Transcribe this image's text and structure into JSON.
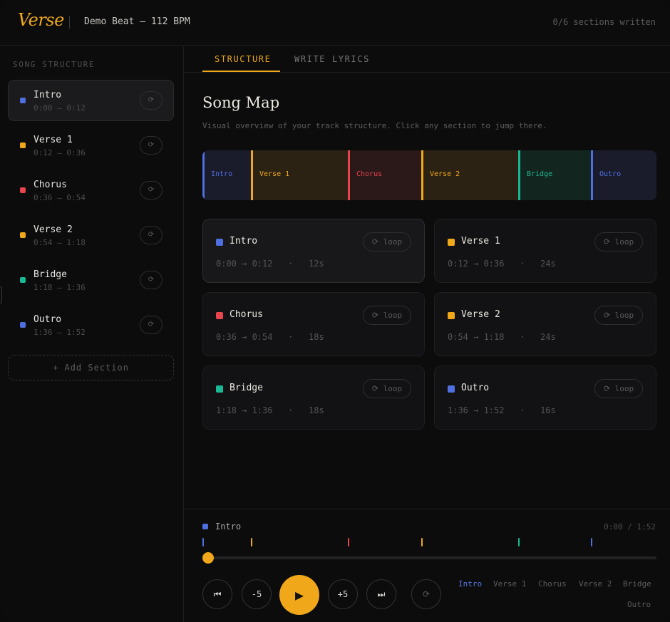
{
  "header": {
    "logo": "Verse",
    "track_title": "Demo Beat — 112 BPM",
    "progress": "0/6 sections written"
  },
  "sidebar": {
    "heading": "SONG STRUCTURE",
    "loop_icon": "⟳",
    "items": [
      {
        "name": "Intro",
        "time": "0:00 – 0:12",
        "color": "#4f6fe0"
      },
      {
        "name": "Verse 1",
        "time": "0:12 – 0:36",
        "color": "#f0a81a"
      },
      {
        "name": "Chorus",
        "time": "0:36 – 0:54",
        "color": "#e8454f"
      },
      {
        "name": "Verse 2",
        "time": "0:54 – 1:18",
        "color": "#f0a81a"
      },
      {
        "name": "Bridge",
        "time": "1:18 – 1:36",
        "color": "#1ab894"
      },
      {
        "name": "Outro",
        "time": "1:36 – 1:52",
        "color": "#4f6fe0"
      }
    ],
    "add_section": "+ Add Section"
  },
  "tabs": {
    "structure": "STRUCTURE",
    "write_lyrics": "WRITE LYRICS"
  },
  "main": {
    "title": "Song Map",
    "subtitle": "Visual overview of your track structure. Click any section to jump there.",
    "segments": [
      {
        "label": "Intro",
        "color": "#4f6fe0",
        "bg": "#1a1c2c"
      },
      {
        "label": "Verse 1",
        "color": "#f0a81a",
        "bg": "#2c2214"
      },
      {
        "label": "Chorus",
        "color": "#e8454f",
        "bg": "#2b1819"
      },
      {
        "label": "Verse 2",
        "color": "#f0a81a",
        "bg": "#2c2214"
      },
      {
        "label": "Bridge",
        "color": "#1ab894",
        "bg": "#13251f"
      },
      {
        "label": "Outro",
        "color": "#4f6fe0",
        "bg": "#1a1c2c"
      }
    ],
    "cards": [
      {
        "name": "Intro",
        "time": "0:00 → 0:12   ·   12s",
        "color": "#4f6fe0",
        "loop": "⟳ loop"
      },
      {
        "name": "Verse 1",
        "time": "0:12 → 0:36   ·   24s",
        "color": "#f0a81a",
        "loop": "⟳ loop"
      },
      {
        "name": "Chorus",
        "time": "0:36 → 0:54   ·   18s",
        "color": "#e8454f",
        "loop": "⟳ loop"
      },
      {
        "name": "Verse 2",
        "time": "0:54 → 1:18   ·   24s",
        "color": "#f0a81a",
        "loop": "⟳ loop"
      },
      {
        "name": "Bridge",
        "time": "1:18 → 1:36   ·   18s",
        "color": "#1ab894",
        "loop": "⟳ loop"
      },
      {
        "name": "Outro",
        "time": "1:36 → 1:52   ·   16s",
        "color": "#4f6fe0",
        "loop": "⟳ loop"
      }
    ]
  },
  "player": {
    "current_section": "Intro",
    "current_color": "#4f6fe0",
    "time": "0:00 / 1:52",
    "progress_fraction": 0,
    "controls": {
      "prev": "⏮",
      "back5": "-5",
      "play": "▶",
      "fwd5": "+5",
      "next": "⏭",
      "loop": "⟳"
    },
    "quick_sections": [
      "Intro",
      "Verse 1",
      "Chorus",
      "Verse 2",
      "Bridge",
      "Outro"
    ]
  },
  "colors": {
    "accent": "#f0a81a",
    "background": "#0c0c0d"
  }
}
